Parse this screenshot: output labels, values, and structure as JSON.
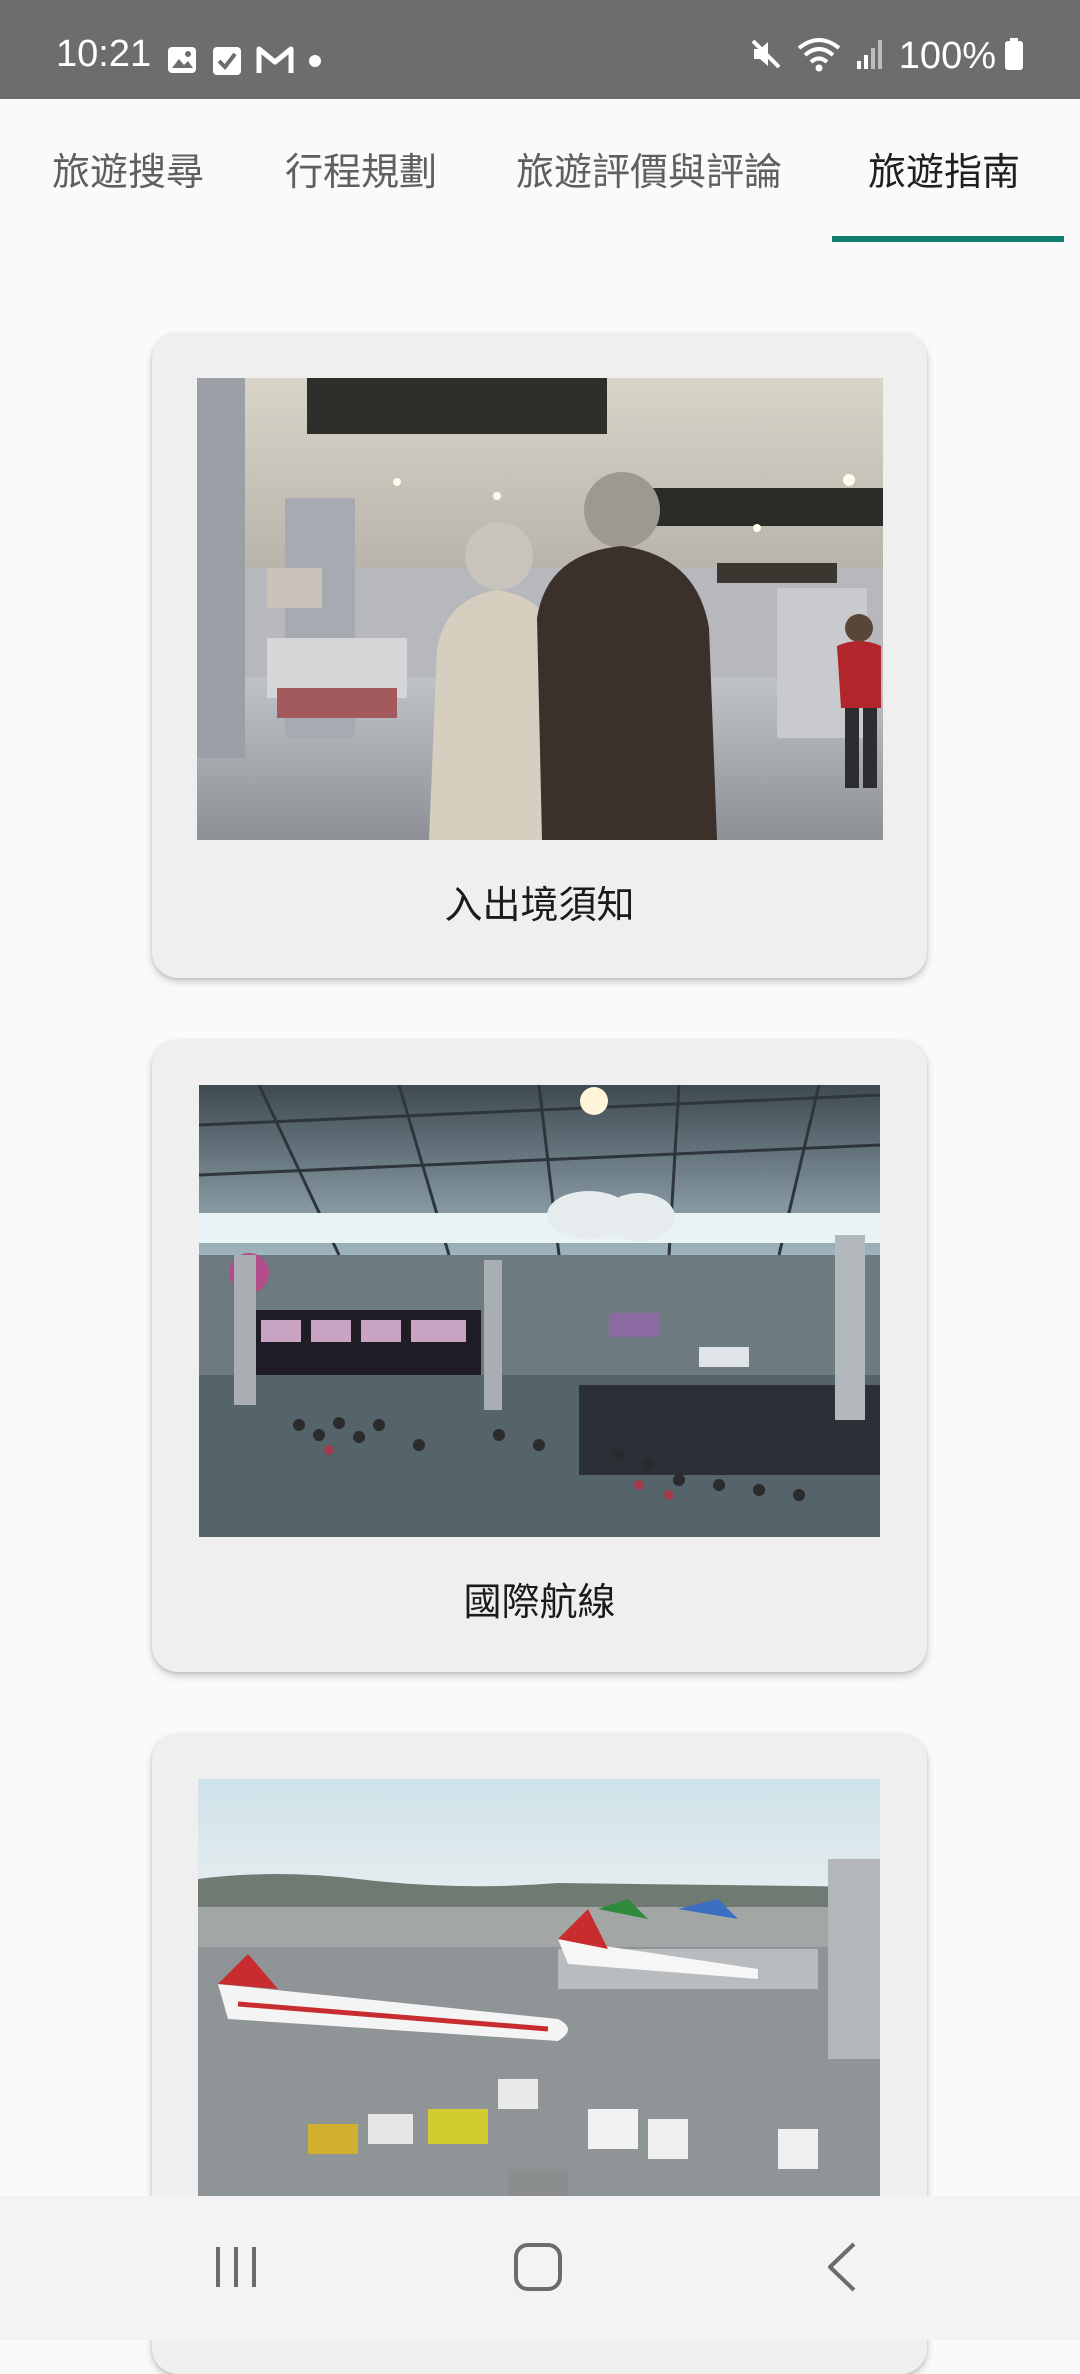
{
  "status_bar": {
    "time": "10:21",
    "notification_icons": [
      "image-icon",
      "checkbox-icon",
      "gmail-icon",
      "dot-icon"
    ],
    "system_icons": [
      "mute-icon",
      "wifi-icon",
      "signal-icon"
    ],
    "battery_percent": "100%"
  },
  "tabs": [
    {
      "label": "旅遊搜尋",
      "active": false
    },
    {
      "label": "行程規劃",
      "active": false
    },
    {
      "label": "旅遊評價與評論",
      "active": false
    },
    {
      "label": "旅遊指南",
      "active": true
    }
  ],
  "accent_color": "#12806f",
  "cards": [
    {
      "title": "入出境須知",
      "image": "airport-terminal-elderly-couple-photo"
    },
    {
      "title": "國際航線",
      "image": "airport-departure-hall-photo"
    },
    {
      "title": "",
      "image": "airport-apron-airplanes-photo"
    }
  ],
  "nav_bar": {
    "buttons": [
      "recent-apps-icon",
      "home-icon",
      "back-icon"
    ]
  }
}
